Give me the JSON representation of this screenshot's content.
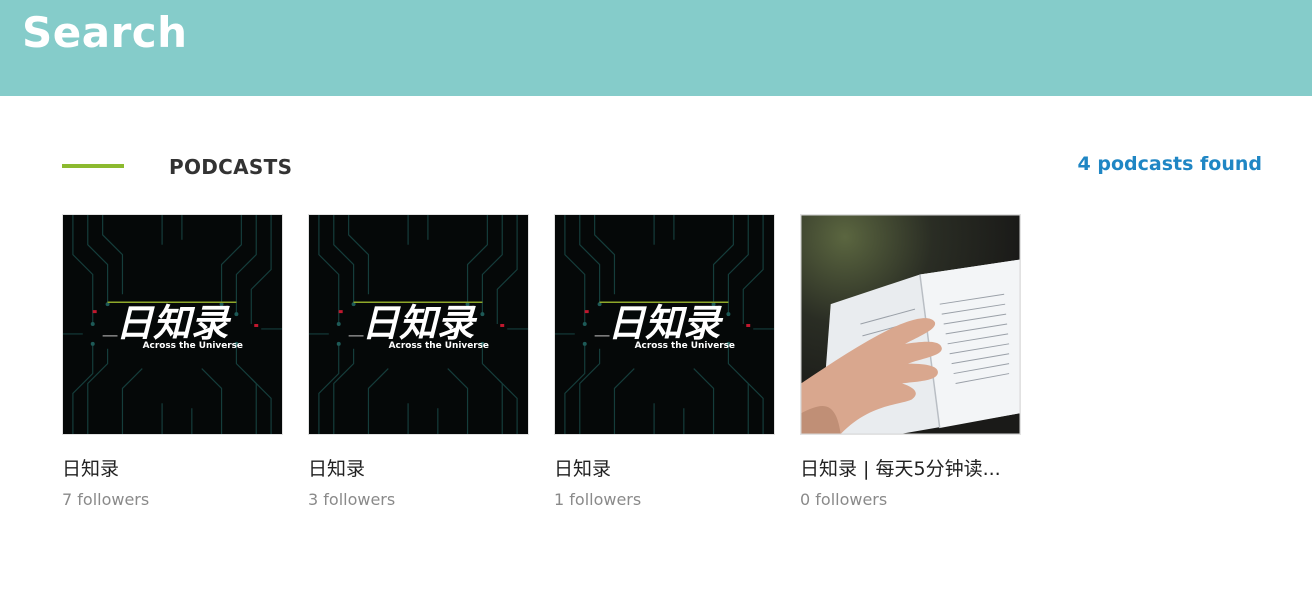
{
  "header": {
    "title": "Search"
  },
  "section": {
    "title": "PODCASTS",
    "found_label": "4 podcasts found",
    "accent_color": "#8cba2f"
  },
  "podcasts": [
    {
      "title": "日知录",
      "followers": "7 followers",
      "cover": "circuit-logo",
      "cover_logo": "日知录",
      "cover_sub": "Across the Universe"
    },
    {
      "title": "日知录",
      "followers": "3 followers",
      "cover": "circuit-logo",
      "cover_logo": "日知录",
      "cover_sub": "Across the Universe"
    },
    {
      "title": "日知录",
      "followers": "1 followers",
      "cover": "circuit-logo",
      "cover_logo": "日知录",
      "cover_sub": "Across the Universe"
    },
    {
      "title": "日知录 | 每天5分钟读...",
      "followers": "0 followers",
      "cover": "open-book-photo"
    }
  ],
  "colors": {
    "header_bg": "#85ccca",
    "link": "#1f86c4"
  }
}
